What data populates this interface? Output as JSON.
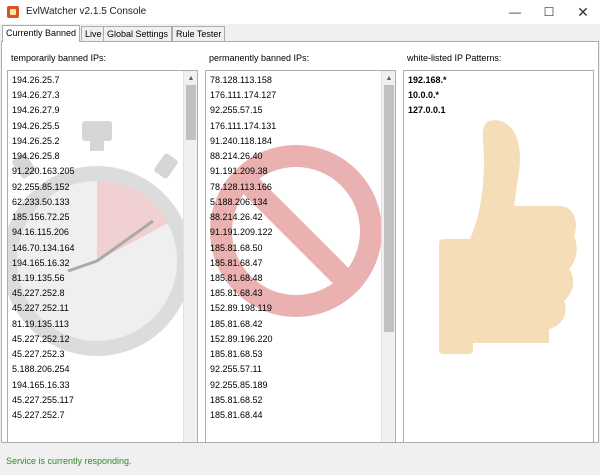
{
  "window": {
    "title": "EvlWatcher v2.1.5 Console",
    "min_glyph": "—",
    "max_glyph": "☐",
    "close_glyph": "✕"
  },
  "tabs": [
    {
      "label": "Currently Banned",
      "active": true
    },
    {
      "label": "Live"
    },
    {
      "label": "Global Settings"
    },
    {
      "label": "Rule Tester"
    }
  ],
  "temporary": {
    "label": "temporarily banned IPs:",
    "items": [
      "194.26.25.7",
      "194.26.27.3",
      "194.26.27.9",
      "194.26.25.5",
      "194.26.25.2",
      "194.26.25.8",
      "91.220.163.205",
      "92.255.85.152",
      "62.233.50.133",
      "185.156.72.25",
      "94.16.115.206",
      "146.70.134.164",
      "194.165.16.32",
      "81.19.135.56",
      "45.227.252.8",
      "45.227.252.11",
      "81.19.135.113",
      "45.227.252.12",
      "45.227.252.3",
      "5.188.206.254",
      "194.165.16.33",
      "45.227.255.117",
      "45.227.252.7"
    ],
    "buttons": [
      "delete-icon",
      "lock-icon",
      "square-icon",
      "folder-icon"
    ]
  },
  "permanent": {
    "label": "permanently banned IPs:",
    "items": [
      "78.128.113.158",
      "176.111.174.127",
      "92.255.57.15",
      "176.111.174.131",
      "91.240.118.184",
      "88.214.26.40",
      "91.191.209.38",
      "78.128.113.166",
      "5.188.206.134",
      "88.214.26.42",
      "91.191.209.122",
      "185.81.68.50",
      "185.81.68.47",
      "185.81.68.48",
      "185.81.68.43",
      "152.89.198.119",
      "185.81.68.42",
      "152.89.196.220",
      "185.81.68.53",
      "92.255.57.11",
      "92.255.85.189",
      "185.81.68.52",
      "185.81.68.44"
    ],
    "input_value": ""
  },
  "whitelist": {
    "label": "white-listed IP Patterns:",
    "items": [
      "192.168.*",
      "10.0.0.*",
      "127.0.0.1"
    ],
    "input_value": ""
  },
  "glyphs": {
    "add": "+",
    "delete": "✖",
    "lock": "🔒",
    "square": "■",
    "folder": "📁",
    "up": "▲",
    "down": "▼"
  },
  "status": {
    "text": "Service is currently responding.",
    "color": "#2e8b2e"
  }
}
